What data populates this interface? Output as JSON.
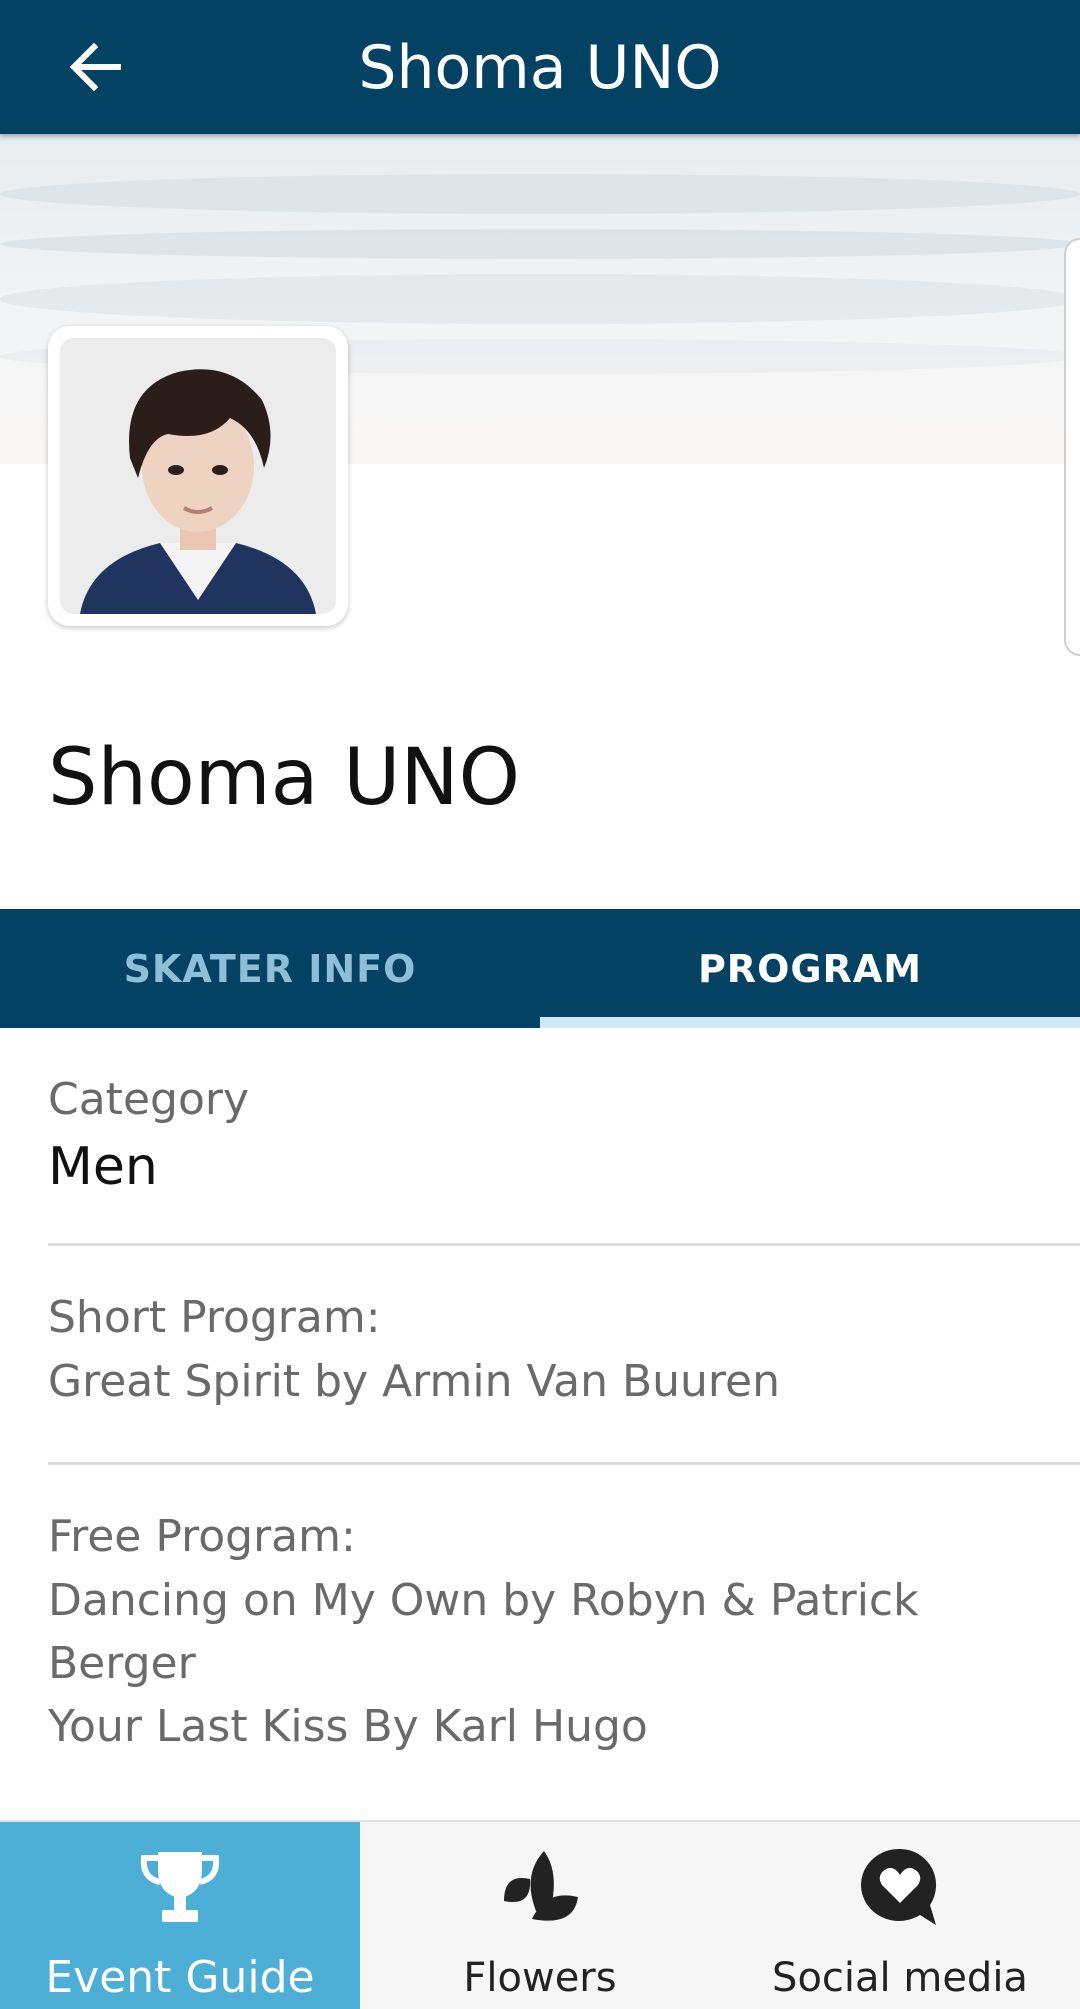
{
  "header": {
    "title": "Shoma UNO",
    "back_icon": "arrow-left-icon"
  },
  "profile": {
    "name": "Shoma UNO",
    "photo": "skater-portrait"
  },
  "tabs": [
    {
      "label": "SKATER INFO",
      "selected": false
    },
    {
      "label": "PROGRAM",
      "selected": true
    }
  ],
  "program": {
    "category_label": "Category",
    "category_value": "Men",
    "short_label": "Short Program:",
    "short_value": "Great Spirit by Armin Van Buuren",
    "free_label": "Free Program:",
    "free_line1": "Dancing on My Own by Robyn & Patrick",
    "free_line2": "Berger",
    "free_line3": "Your Last Kiss By Karl Hugo"
  },
  "bottom_nav": [
    {
      "label": "Event Guide",
      "icon": "trophy-icon",
      "active": true
    },
    {
      "label": "Flowers",
      "icon": "flower-icon",
      "active": false
    },
    {
      "label": "Social media",
      "icon": "chat-heart-icon",
      "active": false
    }
  ],
  "colors": {
    "primary": "#044263",
    "tab_indicator": "#cdeaf6",
    "active_nav": "#4eafd6",
    "inactive_tab_text": "#8fbfd8"
  }
}
